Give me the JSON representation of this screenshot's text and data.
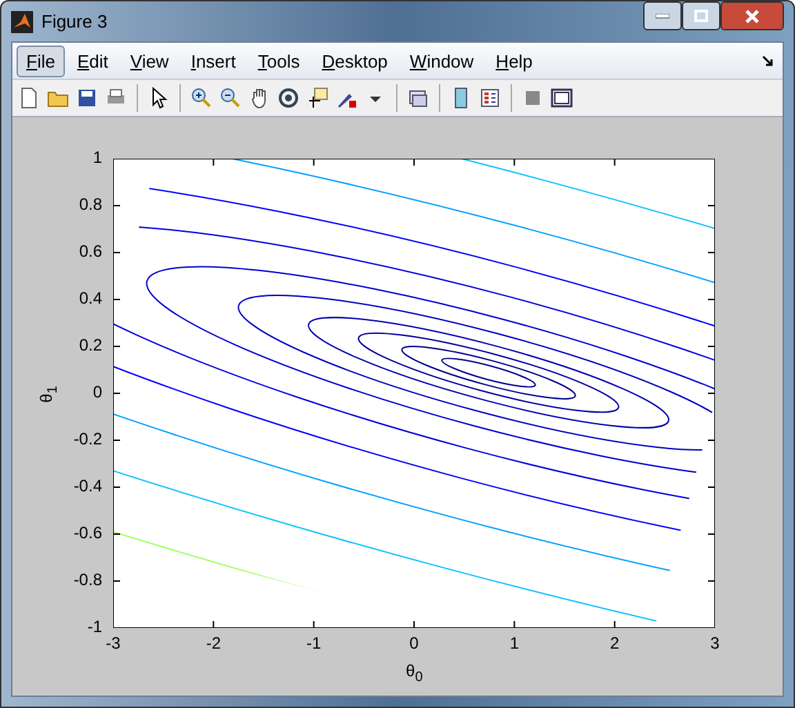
{
  "window": {
    "title": "Figure 3"
  },
  "menu": [
    {
      "label": "File",
      "selected": true
    },
    {
      "label": "Edit",
      "selected": false
    },
    {
      "label": "View",
      "selected": false
    },
    {
      "label": "Insert",
      "selected": false
    },
    {
      "label": "Tools",
      "selected": false
    },
    {
      "label": "Desktop",
      "selected": false
    },
    {
      "label": "Window",
      "selected": false
    },
    {
      "label": "Help",
      "selected": false
    }
  ],
  "plot": {
    "xlabel": "θ$_{0}$",
    "ylabel": "θ$_{1}$",
    "xticks": [
      "-3",
      "-2",
      "-1",
      "0",
      "1",
      "2",
      "3"
    ],
    "yticks": [
      "1",
      "0.8",
      "0.6",
      "0.4",
      "0.2",
      "0",
      "-0.2",
      "-0.4",
      "-0.6",
      "-0.8",
      "-1"
    ]
  }
}
